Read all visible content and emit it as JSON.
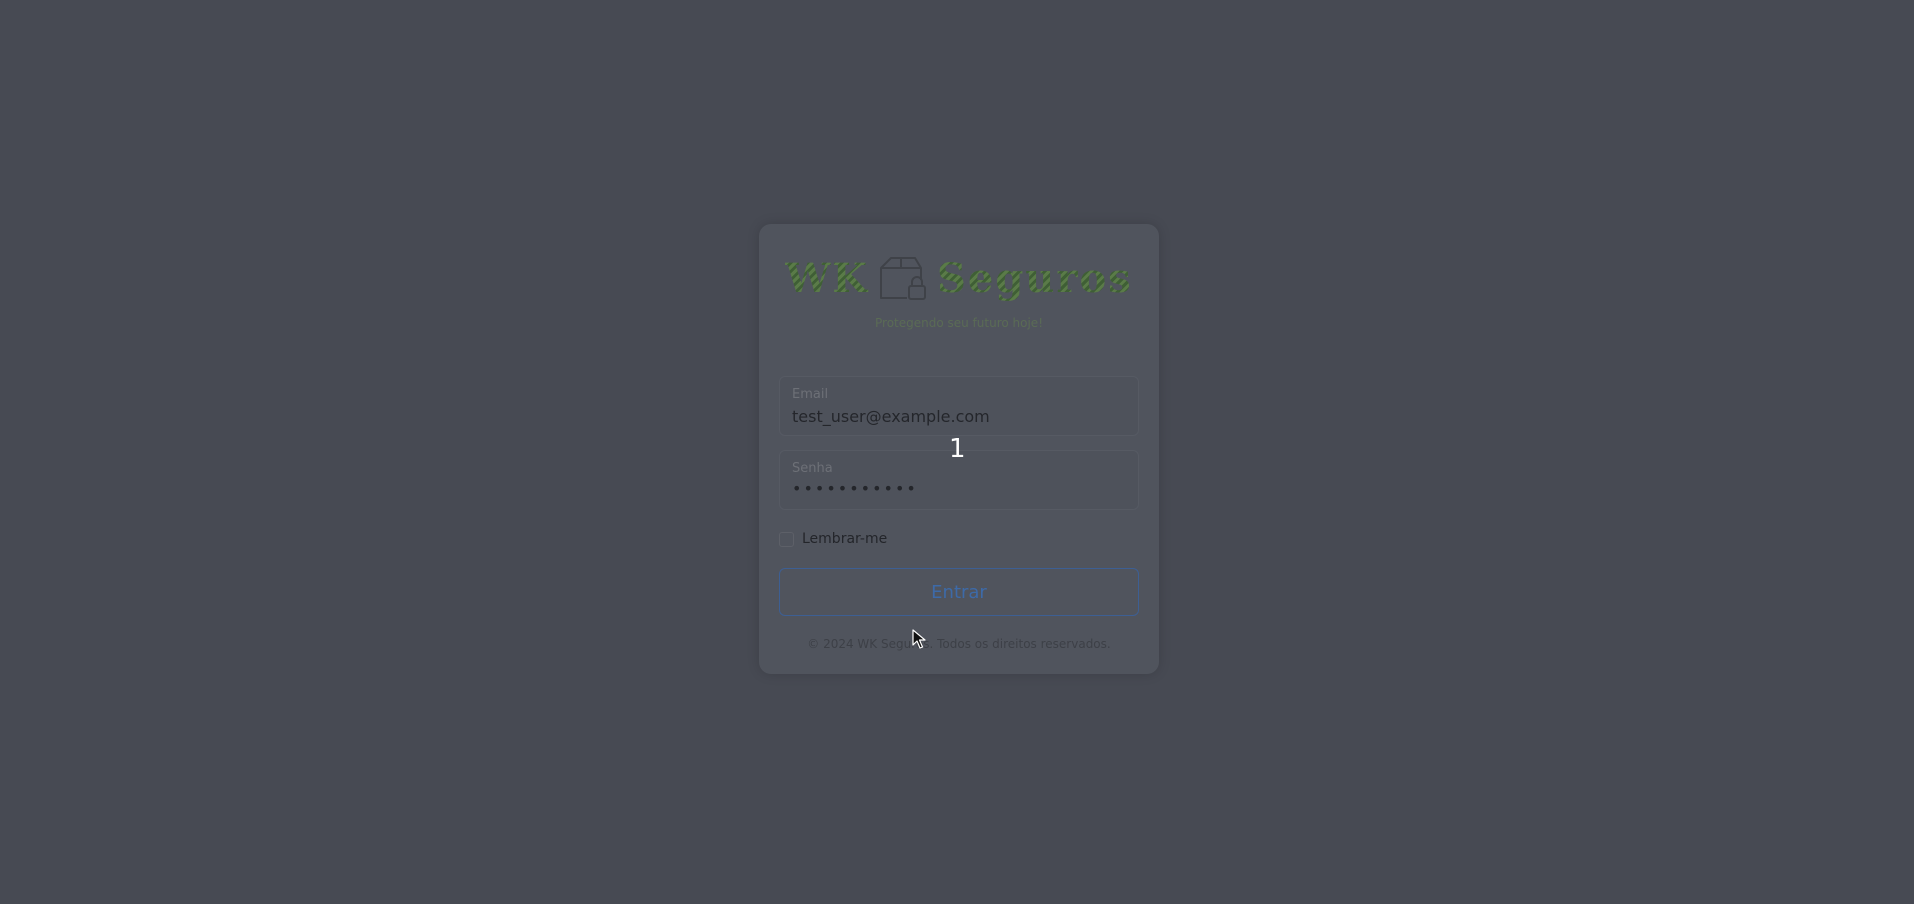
{
  "brand": {
    "name_left": "WK",
    "name_right": "Seguros",
    "tagline": "Protegendo seu futuro hoje!"
  },
  "form": {
    "email_label": "Email",
    "email_value": "test_user@example.com",
    "password_label": "Senha",
    "password_value": "•••••••••••",
    "remember_label": "Lembrar-me",
    "submit_label": "Entrar"
  },
  "marker": "1",
  "footer": "© 2024 WK Seguros. Todos os direitos reservados.",
  "colors": {
    "background_overlay": "#474a53",
    "card": "#50545d",
    "brand_green": "#4f6f3f",
    "button_border": "#3d5f93"
  },
  "icons": {
    "logo": "box-lock-icon",
    "cursor": "mouse-pointer-icon"
  }
}
